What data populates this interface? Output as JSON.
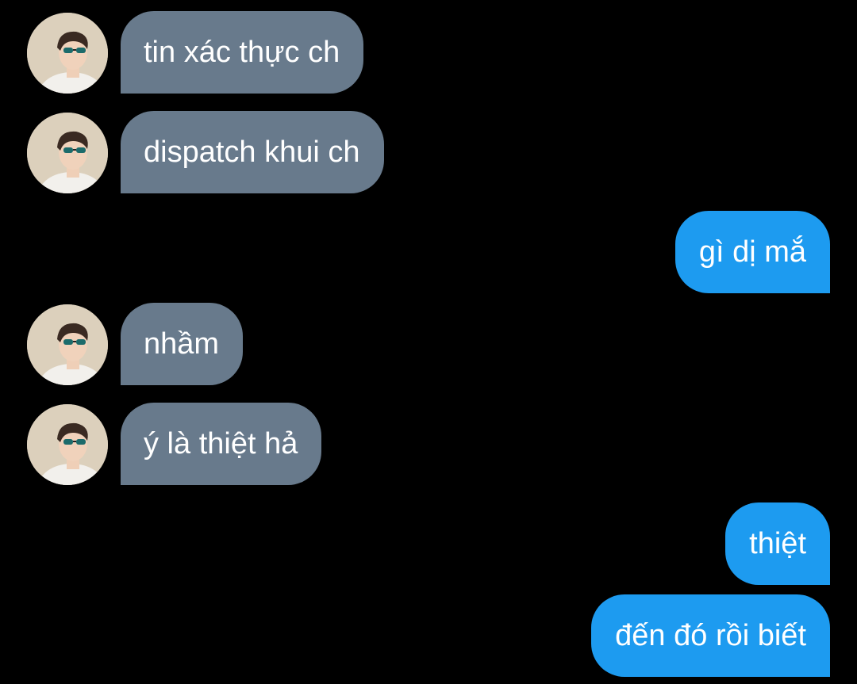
{
  "conversation": {
    "messages": [
      {
        "side": "incoming",
        "text": "tin xác thực ch"
      },
      {
        "side": "incoming",
        "text": "dispatch khui ch"
      },
      {
        "side": "outgoing",
        "text": "gì dị mắ"
      },
      {
        "side": "incoming",
        "text": "nhầm"
      },
      {
        "side": "incoming",
        "text": "ý là thiệt hả"
      },
      {
        "side": "outgoing",
        "text": "thiệt"
      },
      {
        "side": "outgoing",
        "text": "đến đó rồi biết"
      }
    ]
  },
  "colors": {
    "background": "#000000",
    "incoming_bubble": "#687a8c",
    "outgoing_bubble": "#1d9bf0",
    "text": "#ffffff"
  },
  "icons": {
    "avatar": "user-avatar-photo"
  }
}
